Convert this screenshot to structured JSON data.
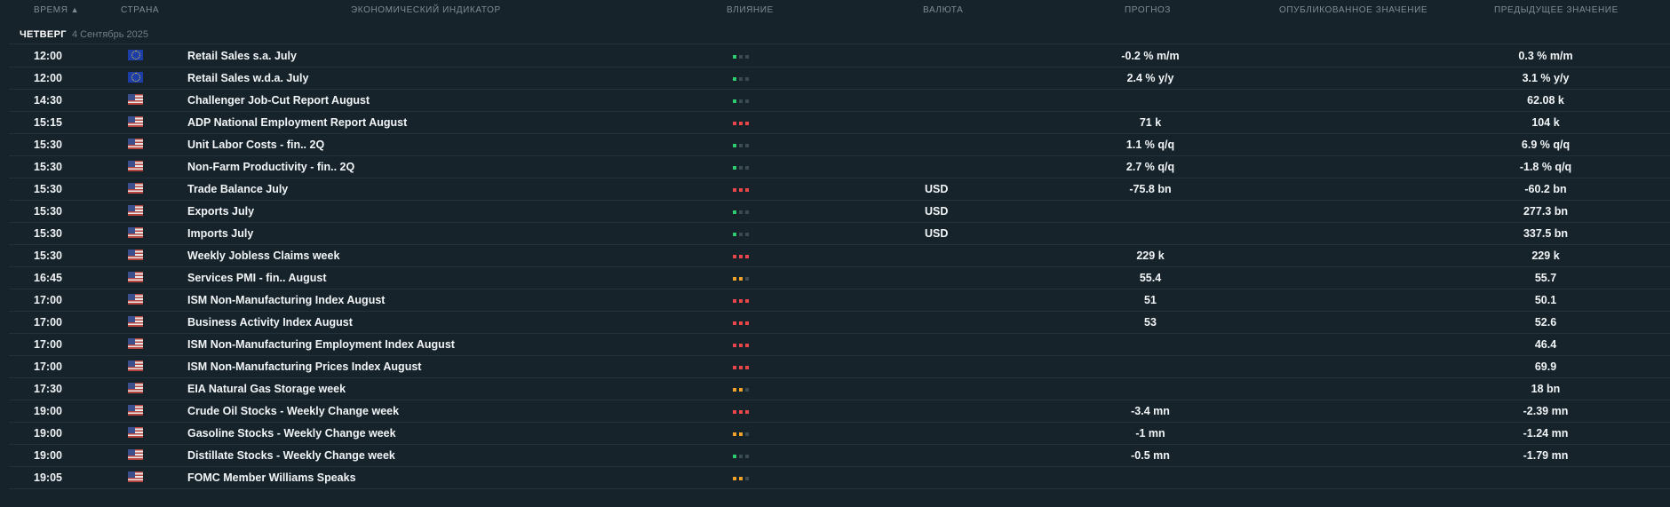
{
  "header": {
    "time": "Время",
    "sort_arrow": "▲",
    "country": "Страна",
    "indicator": "Экономический индикатор",
    "impact": "Влияние",
    "currency": "Валюта",
    "forecast": "Прогноз",
    "published": "Опубликованное значение",
    "previous": "Предыдущее значение"
  },
  "day": {
    "name": "Четверг",
    "date": "4 Сентябрь 2025"
  },
  "colors": {
    "impact_high": "#e8464a",
    "impact_medium": "#f0a22a",
    "impact_low": "#2ecc71",
    "impact_off": "#3a4a52"
  },
  "events": [
    {
      "time": "12:00",
      "country": "EU",
      "flag_icon": "eu-flag-icon",
      "name": "Retail Sales s.a. July",
      "impact": "low",
      "currency": "",
      "forecast": "-0.2 % m/m",
      "published": "",
      "previous": "0.3 % m/m"
    },
    {
      "time": "12:00",
      "country": "EU",
      "flag_icon": "eu-flag-icon",
      "name": "Retail Sales w.d.a. July",
      "impact": "low",
      "currency": "",
      "forecast": "2.4 % y/y",
      "published": "",
      "previous": "3.1 % y/y"
    },
    {
      "time": "14:30",
      "country": "US",
      "flag_icon": "us-flag-icon",
      "name": "Challenger Job-Cut Report August",
      "impact": "low",
      "currency": "",
      "forecast": "",
      "published": "",
      "previous": "62.08 k"
    },
    {
      "time": "15:15",
      "country": "US",
      "flag_icon": "us-flag-icon",
      "name": "ADP National Employment Report August",
      "impact": "high",
      "currency": "",
      "forecast": "71 k",
      "published": "",
      "previous": "104 k"
    },
    {
      "time": "15:30",
      "country": "US",
      "flag_icon": "us-flag-icon",
      "name": "Unit Labor Costs - fin.. 2Q",
      "impact": "low",
      "currency": "",
      "forecast": "1.1 % q/q",
      "published": "",
      "previous": "6.9 % q/q"
    },
    {
      "time": "15:30",
      "country": "US",
      "flag_icon": "us-flag-icon",
      "name": "Non-Farm Productivity - fin.. 2Q",
      "impact": "low",
      "currency": "",
      "forecast": "2.7 % q/q",
      "published": "",
      "previous": "-1.8 % q/q"
    },
    {
      "time": "15:30",
      "country": "US",
      "flag_icon": "us-flag-icon",
      "name": "Trade Balance July",
      "impact": "high",
      "currency": "USD",
      "forecast": "-75.8 bn",
      "published": "",
      "previous": "-60.2 bn"
    },
    {
      "time": "15:30",
      "country": "US",
      "flag_icon": "us-flag-icon",
      "name": "Exports July",
      "impact": "low",
      "currency": "USD",
      "forecast": "",
      "published": "",
      "previous": "277.3 bn"
    },
    {
      "time": "15:30",
      "country": "US",
      "flag_icon": "us-flag-icon",
      "name": "Imports July",
      "impact": "low",
      "currency": "USD",
      "forecast": "",
      "published": "",
      "previous": "337.5 bn"
    },
    {
      "time": "15:30",
      "country": "US",
      "flag_icon": "us-flag-icon",
      "name": "Weekly Jobless Claims week",
      "impact": "high",
      "currency": "",
      "forecast": "229 k",
      "published": "",
      "previous": "229 k"
    },
    {
      "time": "16:45",
      "country": "US",
      "flag_icon": "us-flag-icon",
      "name": "Services PMI - fin.. August",
      "impact": "medium",
      "currency": "",
      "forecast": "55.4",
      "published": "",
      "previous": "55.7"
    },
    {
      "time": "17:00",
      "country": "US",
      "flag_icon": "us-flag-icon",
      "name": "ISM Non-Manufacturing Index August",
      "impact": "high",
      "currency": "",
      "forecast": "51",
      "published": "",
      "previous": "50.1"
    },
    {
      "time": "17:00",
      "country": "US",
      "flag_icon": "us-flag-icon",
      "name": "Business Activity Index August",
      "impact": "high",
      "currency": "",
      "forecast": "53",
      "published": "",
      "previous": "52.6"
    },
    {
      "time": "17:00",
      "country": "US",
      "flag_icon": "us-flag-icon",
      "name": "ISM Non-Manufacturing Employment Index August",
      "impact": "high",
      "currency": "",
      "forecast": "",
      "published": "",
      "previous": "46.4"
    },
    {
      "time": "17:00",
      "country": "US",
      "flag_icon": "us-flag-icon",
      "name": "ISM Non-Manufacturing Prices Index August",
      "impact": "high",
      "currency": "",
      "forecast": "",
      "published": "",
      "previous": "69.9"
    },
    {
      "time": "17:30",
      "country": "US",
      "flag_icon": "us-flag-icon",
      "name": "EIA Natural Gas Storage week",
      "impact": "medium",
      "currency": "",
      "forecast": "",
      "published": "",
      "previous": "18 bn"
    },
    {
      "time": "19:00",
      "country": "US",
      "flag_icon": "us-flag-icon",
      "name": "Crude Oil Stocks - Weekly Change week",
      "impact": "high",
      "currency": "",
      "forecast": "-3.4 mn",
      "published": "",
      "previous": "-2.39 mn"
    },
    {
      "time": "19:00",
      "country": "US",
      "flag_icon": "us-flag-icon",
      "name": "Gasoline Stocks - Weekly Change week",
      "impact": "medium",
      "currency": "",
      "forecast": "-1 mn",
      "published": "",
      "previous": "-1.24 mn"
    },
    {
      "time": "19:00",
      "country": "US",
      "flag_icon": "us-flag-icon",
      "name": "Distillate Stocks - Weekly Change week",
      "impact": "low",
      "currency": "",
      "forecast": "-0.5 mn",
      "published": "",
      "previous": "-1.79 mn"
    },
    {
      "time": "19:05",
      "country": "US",
      "flag_icon": "us-flag-icon",
      "name": "FOMC Member Williams Speaks",
      "impact": "medium",
      "currency": "",
      "forecast": "",
      "published": "",
      "previous": ""
    }
  ]
}
